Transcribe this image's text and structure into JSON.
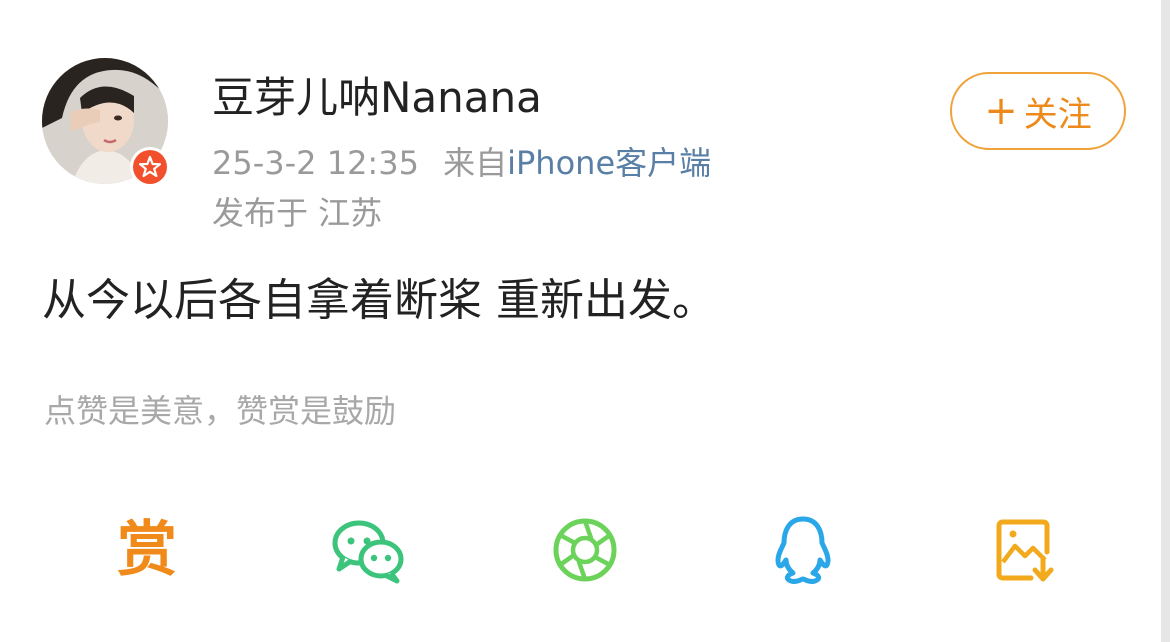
{
  "post": {
    "author": {
      "name": "豆芽儿呐Nanana"
    },
    "time": "25-3-2 12:35",
    "source_prefix": "来自",
    "source_client": "iPhone客户端",
    "location": "发布于 江苏",
    "follow": {
      "plus": "+",
      "label": "关注"
    },
    "text": "从今以后各自拿着断桨 重新出发。",
    "reward_note": "点赞是美意，赞赏是鼓励"
  },
  "share_bar": {
    "reward_label": "赏",
    "items": [
      {
        "icon": "reward-icon",
        "color": "#f08a1a"
      },
      {
        "icon": "wechat-icon",
        "color": "#3cc47c"
      },
      {
        "icon": "moments-icon",
        "color": "#6bd35a"
      },
      {
        "icon": "qq-icon",
        "color": "#2aa7e8"
      },
      {
        "icon": "save-image-icon",
        "color": "#f2a91b"
      }
    ]
  }
}
